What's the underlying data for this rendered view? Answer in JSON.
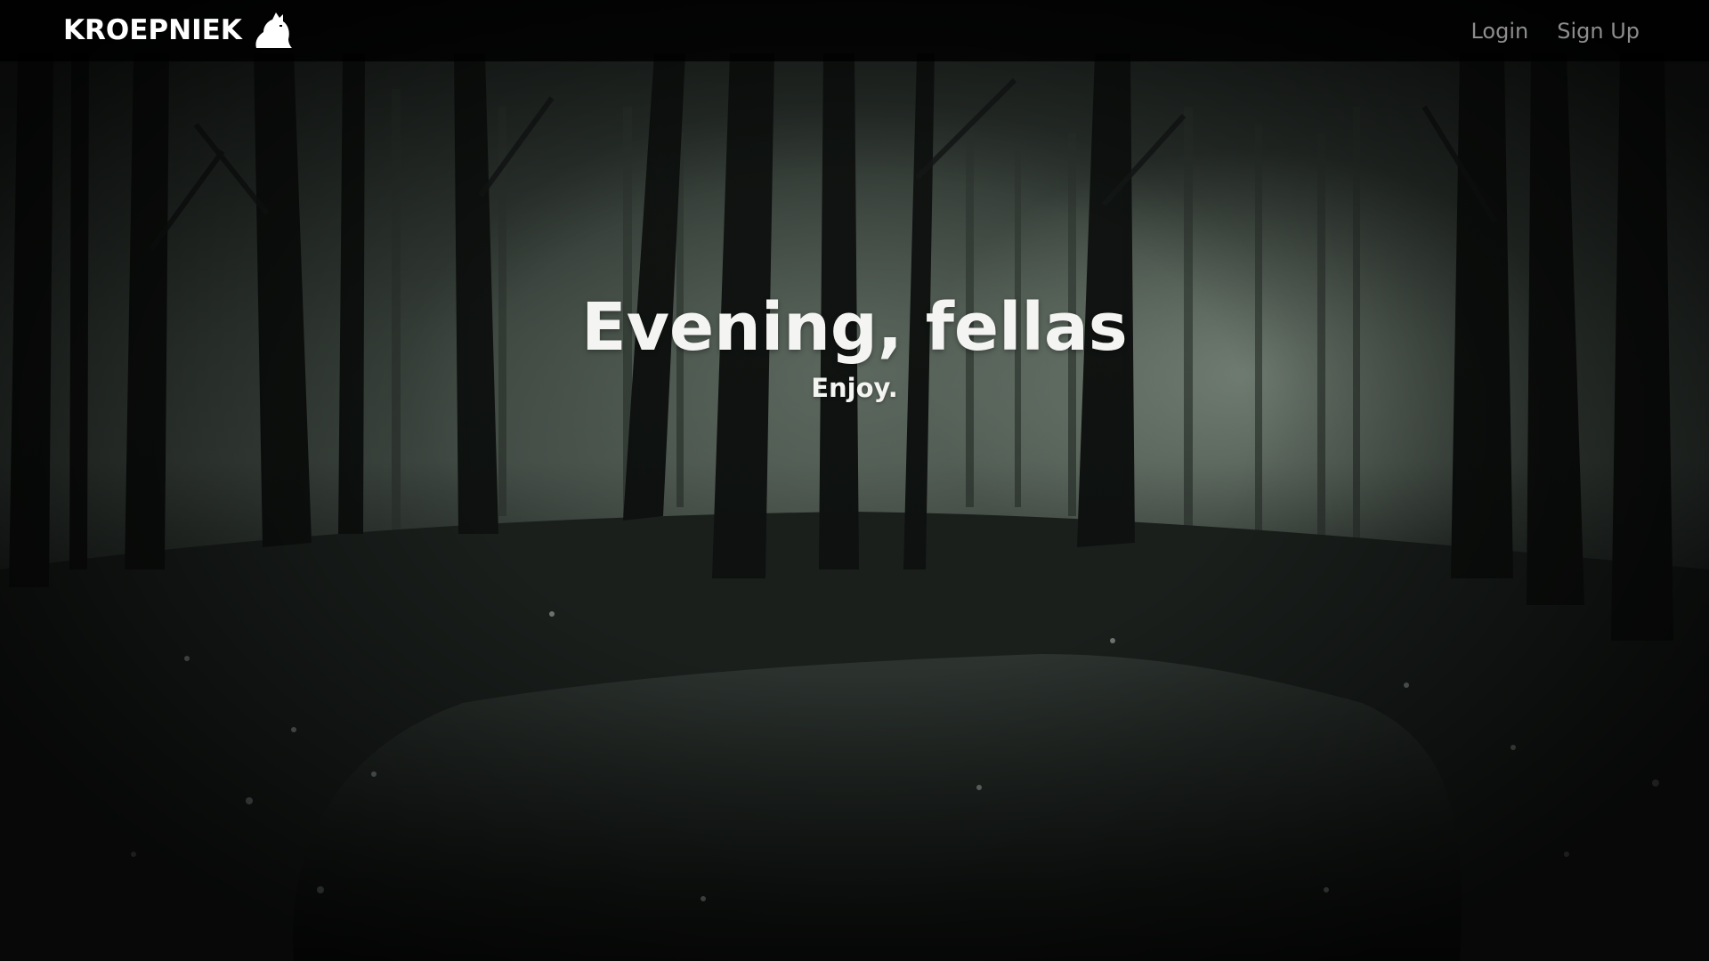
{
  "navbar": {
    "brand": "KROEPNIEK",
    "brand_icon": "kroepniek-logo-icon",
    "links": [
      {
        "label": "Login"
      },
      {
        "label": "Sign Up"
      }
    ],
    "colors": {
      "background": "#000000",
      "brand_text": "#ffffff",
      "link_text": "#8d8d8d"
    }
  },
  "hero": {
    "title": "Evening, fellas",
    "subtitle": "Enjoy.",
    "text_color": "#f4f4f2",
    "background": "misty-forest-photo"
  }
}
